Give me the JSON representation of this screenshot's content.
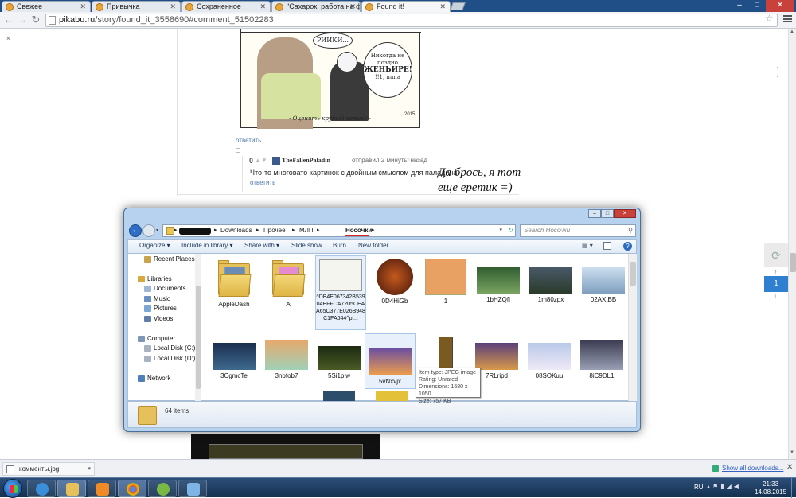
{
  "browser": {
    "tabs": [
      {
        "label": "Свежее",
        "active": false
      },
      {
        "label": "Привычка",
        "active": false
      },
      {
        "label": "Сохраненное",
        "active": false
      },
      {
        "label": "\"Сахарок, работа на фер",
        "active": false
      },
      {
        "label": "Found it!",
        "active": true
      }
    ],
    "window_controls": [
      "–",
      "□",
      "✕"
    ],
    "url_domain": "pikabu.ru",
    "url_path": "/story/found_it_3558690#comment_51502283"
  },
  "page": {
    "comic": {
      "bubble1": "РИИКИ...",
      "bubble2_line1": "Никогда не",
      "bubble2_line2": "поздно",
      "bubble2_big": "ЖЕНЬИРЕ!",
      "bubble2_line3": "!!1, папа",
      "caption": "- Оценить крутой комикс -",
      "signature": "2015"
    },
    "reply_label_1": "ответить",
    "comment": {
      "score": "0",
      "username": "TheFallenPaladin",
      "meta": "отправил 2 минуты назад",
      "text": "Что-то многовато картинок с двойным смыслом для паладина",
      "reply_label": "ответить"
    },
    "overlay_text_line1": "Да брось, я тот",
    "overlay_text_line2": "еще еретик =)",
    "pager": {
      "page": "1"
    },
    "accent_color": "#2f80d1"
  },
  "explorer": {
    "window_controls": [
      "–",
      "□",
      "✕"
    ],
    "breadcrumbs": [
      "Downloads",
      "Прочее",
      "МЛП",
      "Носочки"
    ],
    "search_placeholder": "Search Носочки",
    "commands": [
      "Organize ▾",
      "Include in library ▾",
      "Share with ▾",
      "Slide show",
      "Burn",
      "New folder"
    ],
    "nav": [
      {
        "label": "Recent Places",
        "sub": true,
        "icon": "recent-places-icon"
      },
      {
        "label": "Libraries",
        "sub": false,
        "icon": "libraries-icon"
      },
      {
        "label": "Documents",
        "sub": true,
        "icon": "documents-icon"
      },
      {
        "label": "Music",
        "sub": true,
        "icon": "music-icon"
      },
      {
        "label": "Pictures",
        "sub": true,
        "icon": "pictures-icon"
      },
      {
        "label": "Videos",
        "sub": true,
        "icon": "videos-icon"
      },
      {
        "label": "Computer",
        "sub": false,
        "icon": "computer-icon"
      },
      {
        "label": "Local Disk (C:)",
        "sub": true,
        "icon": "disk-icon"
      },
      {
        "label": "Local Disk (D:)",
        "sub": true,
        "icon": "disk-icon"
      },
      {
        "label": "Network",
        "sub": false,
        "icon": "network-icon"
      }
    ],
    "files_row1": [
      {
        "name": "AppleDash",
        "kind": "folder"
      },
      {
        "name": "A",
        "kind": "folder"
      },
      {
        "name": "^DB4E067342B53904EFFCA7205CEAA65C377E026B948C1FA644^pi...",
        "kind": "image"
      },
      {
        "name": "0D4HiGb",
        "kind": "image"
      },
      {
        "name": "1",
        "kind": "image"
      },
      {
        "name": "1bHZQfj",
        "kind": "image"
      },
      {
        "name": "1m80zpx",
        "kind": "image"
      },
      {
        "name": "02AXtBB",
        "kind": "image"
      }
    ],
    "files_row2": [
      {
        "name": "3CgmcTe",
        "kind": "image"
      },
      {
        "name": "3nbfob7",
        "kind": "image"
      },
      {
        "name": "5Si1piw",
        "kind": "image"
      },
      {
        "name": "5vNxvjx",
        "kind": "image"
      },
      {
        "name": "",
        "kind": "image"
      },
      {
        "name": "7RLripd",
        "kind": "image"
      },
      {
        "name": "08SOKuu",
        "kind": "image"
      },
      {
        "name": "8iC9DL1",
        "kind": "image"
      }
    ],
    "tooltip": {
      "type": "Item type: JPEG image",
      "rating": "Rating: Unrated",
      "dimensions": "Dimensions: 1680 x 1050",
      "size": "Size: 757 KB"
    },
    "status": "64 items"
  },
  "downloads": {
    "item": "комменты.jpg",
    "show_all": "Show all downloads..."
  },
  "taskbar": {
    "lang": "RU",
    "time": "21:33",
    "date": "14.08.2015"
  }
}
